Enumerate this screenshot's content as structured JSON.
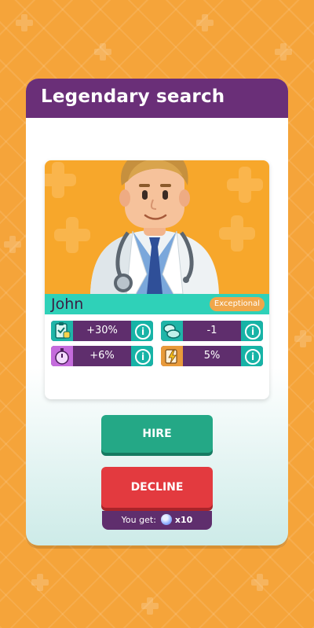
{
  "dialog": {
    "title": "Legendary search"
  },
  "candidate": {
    "name": "John",
    "rank": "Exceptional",
    "stats": [
      {
        "icon": "clipboard-icon",
        "value": "+30%"
      },
      {
        "icon": "pills-icon",
        "value": "-1"
      },
      {
        "icon": "stopwatch-icon",
        "value": "+6%"
      },
      {
        "icon": "lightning-icon",
        "value": "5%"
      }
    ]
  },
  "actions": {
    "hire_label": "HIRE",
    "decline_label": "DECLINE",
    "reward_label": "You get:",
    "reward_icon": "gem-icon",
    "reward_amount": "x10"
  },
  "colors": {
    "background": "#f5a43a",
    "header": "#6a2f78",
    "name_bar": "#2fd1b8",
    "stat_bar": "#5f2e6d",
    "info_button": "#17b3a6",
    "hire": "#24a886",
    "decline": "#e33a3f",
    "rank_badge": "#f0a64a"
  }
}
